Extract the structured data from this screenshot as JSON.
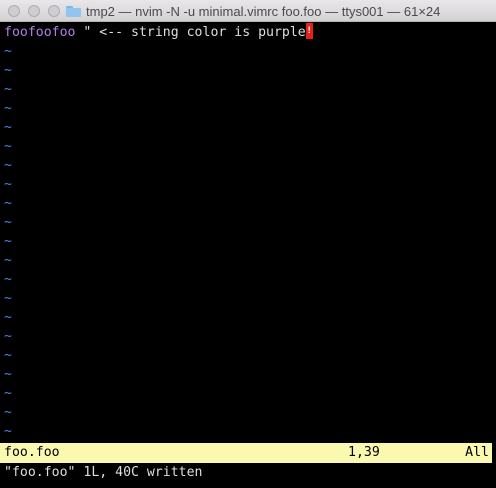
{
  "window": {
    "title": "tmp2 — nvim -N -u minimal.vimrc foo.foo — ttys001 — 61×24"
  },
  "buffer": {
    "line1": {
      "highlighted_text": "foofoofoo",
      "rest_text": " \" <-- string color is purple",
      "cursor_glyph": "!"
    },
    "empty_line_marker": "~"
  },
  "statusline": {
    "filename": "foo.foo",
    "position": "1,39",
    "scroll": "All"
  },
  "message": "\"foo.foo\" 1L, 40C written",
  "colors": {
    "string_purple": "#b17ee7",
    "tilde_blue": "#4f7fe0",
    "statusline_bg": "#fbf9b0",
    "cursor_red": "#e4211b"
  }
}
